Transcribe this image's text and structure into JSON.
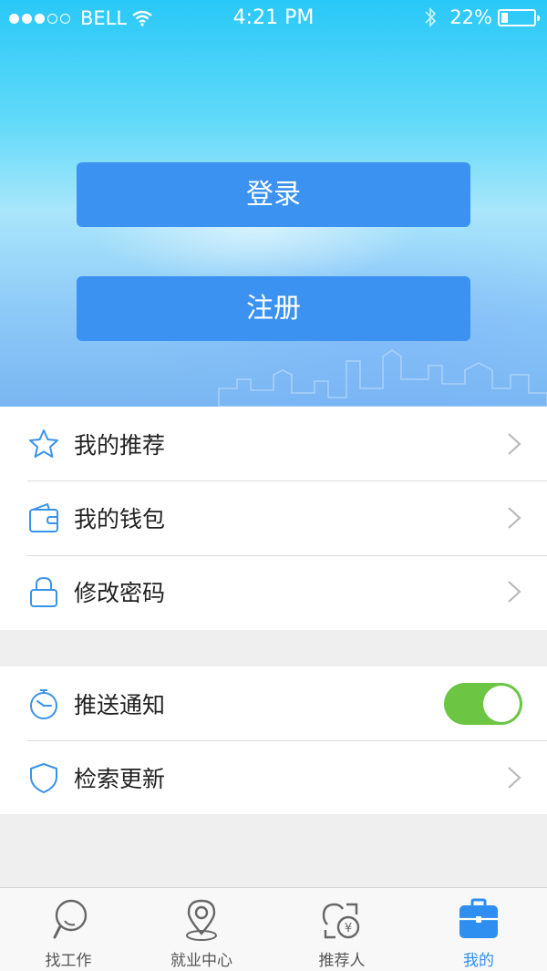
{
  "status_bar": {
    "carrier": "BELL",
    "time": "4:21 PM",
    "battery": "22%",
    "battery_level": 0.22,
    "signal_bars": 3,
    "signal_total": 5
  },
  "auth": {
    "login_label": "登录",
    "register_label": "注册"
  },
  "menu_group1": [
    {
      "label": "我的推荐",
      "icon": "star-icon"
    },
    {
      "label": "我的钱包",
      "icon": "wallet-icon"
    },
    {
      "label": "修改密码",
      "icon": "lock-icon"
    }
  ],
  "menu_group2": [
    {
      "label": "推送通知",
      "icon": "stopwatch-icon",
      "toggle": true
    },
    {
      "label": "检索更新",
      "icon": "shield-icon"
    }
  ],
  "tabs": [
    {
      "label": "找工作",
      "icon": "magnifier-icon",
      "active": false
    },
    {
      "label": "就业中心",
      "icon": "location-pin-icon",
      "active": false
    },
    {
      "label": "推荐人",
      "icon": "referral-icon",
      "active": false
    },
    {
      "label": "我的",
      "icon": "briefcase-icon",
      "active": true
    }
  ],
  "colors": {
    "accent": "#2f8ff0",
    "button": "#3b92f1",
    "toggle_on": "#6cc644",
    "icon_blue": "#3a93ea"
  }
}
